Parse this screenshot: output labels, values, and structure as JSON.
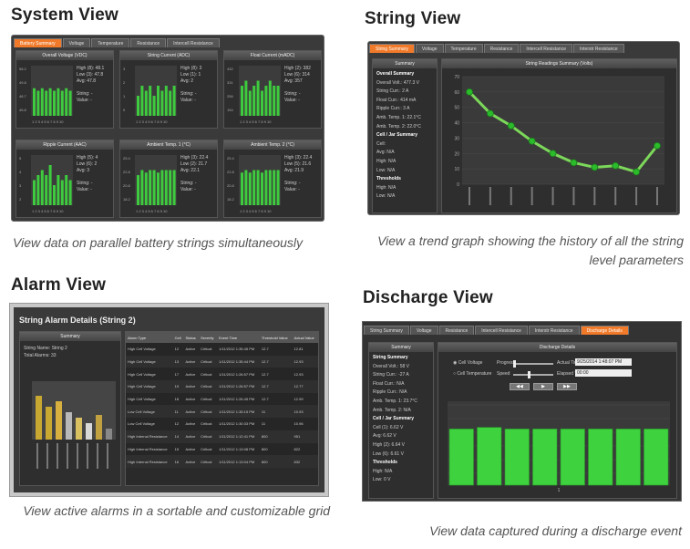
{
  "system": {
    "heading": "System View",
    "caption": "View data on parallel battery strings simultaneously",
    "tabs": [
      "Battery Summary",
      "Voltage",
      "Temperature",
      "Resistance",
      "Intercell Resistance"
    ],
    "panels": [
      {
        "title": "Overall Voltage (VDC)",
        "ticks": [
          "58.2",
          "49.8",
          "48.7",
          "45.8"
        ],
        "stats": [
          "High (8): 48.1",
          "Low (3): 47.8",
          "Avg: 47.8",
          "",
          "String: -",
          "Value: -"
        ],
        "bars": [
          0.55,
          0.5,
          0.55,
          0.5,
          0.55,
          0.5,
          0.55,
          0.5,
          0.55,
          0.5
        ]
      },
      {
        "title": "String Current (ADC)",
        "ticks": [
          "3",
          "2",
          "1",
          "0"
        ],
        "stats": [
          "High (8): 3",
          "Low (1): 1",
          "Avg: 2",
          "",
          "String: -",
          "Value: -"
        ],
        "bars": [
          0.4,
          0.6,
          0.5,
          0.6,
          0.4,
          0.6,
          0.5,
          0.6,
          0.5,
          0.6
        ]
      },
      {
        "title": "Float Current (mADC)",
        "ticks": [
          "432",
          "331",
          "256",
          "154"
        ],
        "stats": [
          "High (2): 382",
          "Low (6): 314",
          "Avg: 357",
          "",
          "String: -",
          "Value: -"
        ],
        "bars": [
          0.6,
          0.7,
          0.5,
          0.6,
          0.7,
          0.5,
          0.6,
          0.7,
          0.6,
          0.6
        ]
      },
      {
        "title": "Ripple Current (AAC)",
        "ticks": [
          "5",
          "4",
          "3",
          "2"
        ],
        "stats": [
          "High (5): 4",
          "Low (6): 2",
          "Avg: 3",
          "",
          "String: -",
          "Value: -"
        ],
        "bars": [
          0.5,
          0.6,
          0.7,
          0.6,
          0.8,
          0.4,
          0.6,
          0.5,
          0.6,
          0.5
        ]
      },
      {
        "title": "Ambient Temp. 1 (°C)",
        "ticks": [
          "25.4",
          "22.8",
          "20.8",
          "18.2"
        ],
        "stats": [
          "High (3): 22.4",
          "Low (2): 21.7",
          "Avg: 22.1",
          "",
          "String: -",
          "Value: -"
        ],
        "bars": [
          0.6,
          0.7,
          0.65,
          0.7,
          0.7,
          0.65,
          0.7,
          0.7,
          0.7,
          0.7
        ]
      },
      {
        "title": "Ambient Temp. 2 (°C)",
        "ticks": [
          "25.4",
          "22.8",
          "20.8",
          "18.2"
        ],
        "stats": [
          "High (3): 22.4",
          "Low (5): 21.6",
          "Avg: 21.9",
          "",
          "String: -",
          "Value: -"
        ],
        "bars": [
          0.65,
          0.7,
          0.65,
          0.7,
          0.7,
          0.65,
          0.7,
          0.7,
          0.7,
          0.7
        ]
      }
    ],
    "xlabels": "1 2 3 4 5 6 7 8 9 10"
  },
  "string": {
    "heading": "String View",
    "caption": "View a trend graph showing the history of all the string level parameters",
    "tabs": [
      "String Summary",
      "Voltage",
      "Temperature",
      "Resistance",
      "Intercell Resistance",
      "Interstr Resistance"
    ],
    "summary_title": "Summary",
    "graph_title": "String Readings Summary (Volts)",
    "summary_lines": [
      "Overall Summary",
      "Overall Volt.: 477.3 V",
      "String Curr.: 2 A",
      "Float Curr.: 414 mA",
      "Ripple Curr.: 3 A",
      "Amb. Temp. 1: 22.1°C",
      "Amb. Temp. 2: 22.0°C",
      "Cell / Jar Summary",
      "Cell:",
      "Avg: N/A",
      "High: N/A",
      "Low: N/A",
      "Thresholds",
      "High: N/A",
      "Low: N/A"
    ],
    "chart_data": {
      "type": "line",
      "y": [
        60,
        46,
        38,
        28,
        20,
        14,
        11,
        12,
        8,
        25
      ],
      "ylim": [
        0,
        70
      ],
      "yticks": [
        "70",
        "60",
        "50",
        "40",
        "30",
        "20",
        "10",
        "0"
      ]
    }
  },
  "alarm": {
    "heading": "Alarm View",
    "caption": "View active alarms in a sortable and customizable grid",
    "title": "String Alarm Details (String 2)",
    "summary_title": "Summary",
    "string_name": "String Name: String 2",
    "total_alarms": "Total Alarms: 33",
    "columns": [
      "Alarm Type",
      "Cell",
      "Status",
      "Severity",
      "Event Time",
      "Threshold Value",
      "Actual Value"
    ],
    "rows": [
      [
        "High Cell Voltage",
        "12",
        "Active",
        "Critical",
        "1/11/2012 1:35:45 PM",
        "12.7",
        "12.81"
      ],
      [
        "High Cell Voltage",
        "13",
        "Active",
        "Critical",
        "1/11/2012 1:35:44 PM",
        "12.7",
        "12.93"
      ],
      [
        "High Cell Voltage",
        "17",
        "Active",
        "Critical",
        "1/11/2012 1:26:57 PM",
        "12.7",
        "12.93"
      ],
      [
        "High Cell Voltage",
        "19",
        "Active",
        "Critical",
        "1/11/2012 1:26:57 PM",
        "12.7",
        "12.77"
      ],
      [
        "High Cell Voltage",
        "18",
        "Active",
        "Critical",
        "1/11/2012 1:26:45 PM",
        "12.7",
        "12.99"
      ],
      [
        "Low Cell Voltage",
        "11",
        "Active",
        "Critical",
        "1/11/2012 1:35:15 PM",
        "11",
        "10.93"
      ],
      [
        "Low Cell Voltage",
        "12",
        "Active",
        "Critical",
        "1/11/2012 1:30:33 PM",
        "11",
        "10.96"
      ],
      [
        "High Internal Resistance",
        "14",
        "Active",
        "Critical",
        "1/11/2012 1:12:41 PM",
        "800",
        "951"
      ],
      [
        "High Internal Resistance",
        "15",
        "Active",
        "Critical",
        "1/11/2012 1:13:08 PM",
        "800",
        "822"
      ],
      [
        "High Internal Resistance",
        "16",
        "Active",
        "Critical",
        "1/11/2012 1:13:04 PM",
        "800",
        "832"
      ]
    ],
    "bars": [
      0.8,
      0.6,
      0.7,
      0.5,
      0.4,
      0.3,
      0.45,
      0.2
    ],
    "bar_colors": [
      "#c8a830",
      "#c8a830",
      "#d8b040",
      "#b8b8b8",
      "#d8c060",
      "#d8d8d8",
      "#c0a040",
      "#888888"
    ]
  },
  "discharge": {
    "heading": "Discharge View",
    "caption": "View data captured during a discharge event",
    "tabs": [
      "String Summary",
      "Voltage",
      "Resistance",
      "Intercell Resistance",
      "Interstr Resistance",
      "Discharge Details"
    ],
    "summary_title": "Summary",
    "details_title": "Discharge Details",
    "summary_lines": [
      "String Summary",
      "Overall Volt.: 58 V",
      "String Curr.: -27 A",
      "Float Curr.: N/A",
      "Ripple Curr.: N/A",
      "Amb. Temp. 1: 23.7°C",
      "Amb. Temp. 2: N/A",
      "Cell / Jar Summary",
      "Cell (1): 6.62 V",
      "Avg: 6.62 V",
      "High (2): 6.64 V",
      "Low (6): 6.61 V",
      "Thresholds",
      "High: N/A",
      "Low: 0 V"
    ],
    "radio1": "Cell Voltage",
    "radio2": "Cell Temperature",
    "progress_label": "Progress",
    "speed_label": "Speed",
    "actual_time_label": "Actual Time",
    "elapsed_time_label": "Elapsed Time",
    "actual_time": "9/25/2014 1:48:07 PM",
    "elapsed_time": "00:00",
    "bars": [
      0.7,
      0.72,
      0.7,
      0.7,
      0.7,
      0.7,
      0.7,
      0.7
    ],
    "xlabel": "1"
  }
}
